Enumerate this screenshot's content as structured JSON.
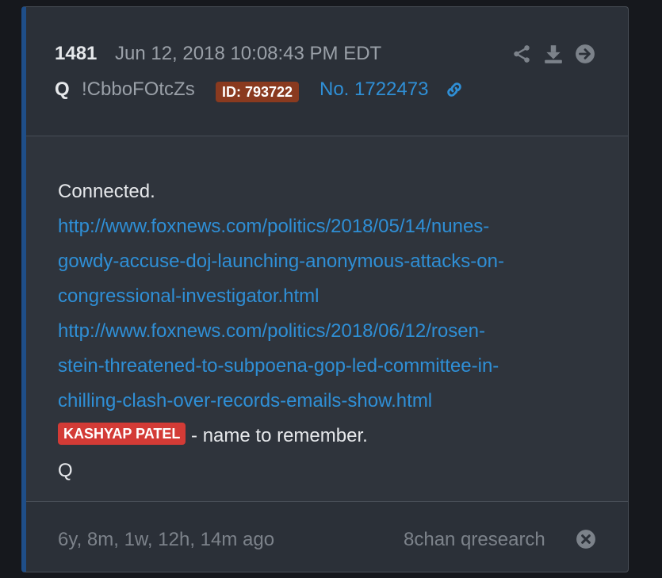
{
  "post": {
    "number": "1481",
    "date": "Jun 12, 2018 10:08:43 PM EDT",
    "author": "Q",
    "tripcode": "!CbboFOtcZs",
    "id_badge": "ID: 793722",
    "post_no": "No. 1722473"
  },
  "header_icons": [
    "share-icon",
    "download-icon",
    "arrow-right-circle-icon",
    "link-icon"
  ],
  "body": {
    "line1": "Connected.",
    "link1": [
      "http://www.foxnews.com/politics/2018/05/14/nunes-",
      "gowdy-accuse-doj-launching-anonymous-attacks-on-",
      "congressional-investigator.html"
    ],
    "link2": [
      "http://www.foxnews.com/politics/2018/06/12/rosen-",
      "stein-threatened-to-subpoena-gop-led-committee-in-",
      "chilling-clash-over-records-emails-show.html"
    ],
    "name_badge": "KASHYAP PATEL",
    "name_suffix": " - name to remember.",
    "signature": "Q"
  },
  "footer": {
    "ago": "6y, 8m, 1w, 12h, 14m ago",
    "source": "8chan qresearch"
  },
  "colors": {
    "accent_bar": "#1f4e88",
    "link": "#2f8fd6",
    "id_badge_bg": "#8a3a1f",
    "name_badge_bg": "#d33b36"
  }
}
